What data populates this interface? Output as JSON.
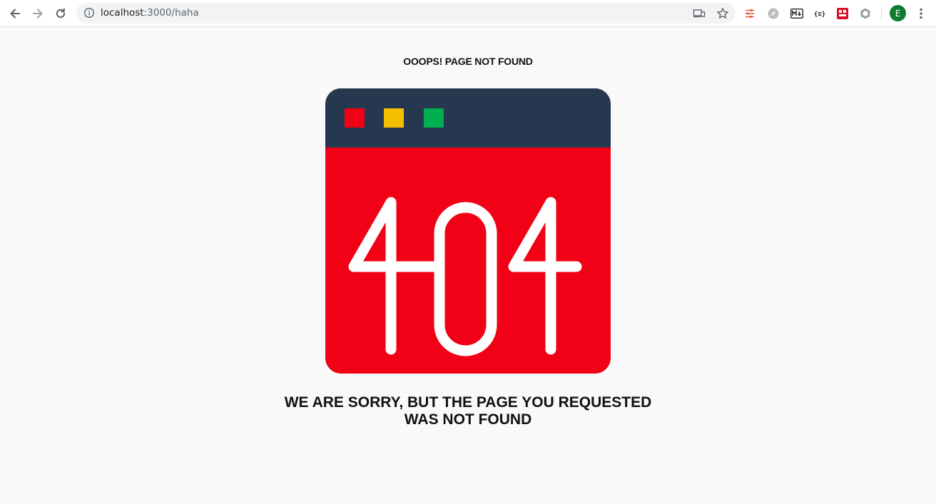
{
  "browser": {
    "url_host": "localhost",
    "url_path": ":3000/haha",
    "profile_initial": "E"
  },
  "page": {
    "small_heading": "OOOPS! PAGE NOT FOUND",
    "error_code": "404",
    "message_line1": "WE ARE SORRY, BUT THE PAGE YOU REQUESTED",
    "message_line2": "WAS NOT FOUND"
  },
  "colors": {
    "card_body": "#f20016",
    "card_header": "#253850",
    "dot_red": "#f20016",
    "dot_yellow": "#f5be00",
    "dot_green": "#00b050"
  }
}
